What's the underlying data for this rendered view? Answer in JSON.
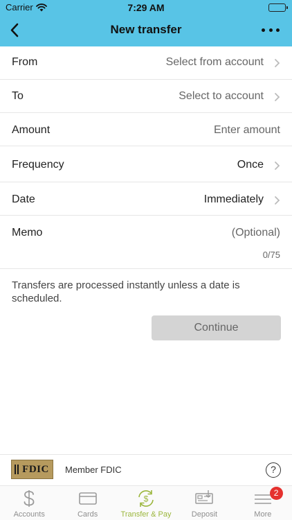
{
  "status_bar": {
    "carrier": "Carrier",
    "time": "7:29 AM"
  },
  "nav": {
    "title": "New transfer"
  },
  "form": {
    "from": {
      "label": "From",
      "value": "Select from account"
    },
    "to": {
      "label": "To",
      "value": "Select to account"
    },
    "amount": {
      "label": "Amount",
      "placeholder": "Enter amount"
    },
    "frequency": {
      "label": "Frequency",
      "value": "Once"
    },
    "date": {
      "label": "Date",
      "value": "Immediately"
    },
    "memo": {
      "label": "Memo",
      "placeholder": "(Optional)",
      "counter": "0/75"
    }
  },
  "info_text": "Transfers are processed instantly unless a date is scheduled.",
  "continue_label": "Continue",
  "footer": {
    "logo_text": "FDIC",
    "member_text": "Member FDIC",
    "help_symbol": "?"
  },
  "tabs": [
    {
      "label": "Accounts",
      "icon": "dollar-icon"
    },
    {
      "label": "Cards",
      "icon": "card-icon"
    },
    {
      "label": "Transfer & Pay",
      "icon": "transfer-icon",
      "active": true
    },
    {
      "label": "Deposit",
      "icon": "check-deposit-icon"
    },
    {
      "label": "More",
      "icon": "menu-icon",
      "badge": "2"
    }
  ],
  "colors": {
    "header": "#58c4e6",
    "active_tab": "#9bb63c",
    "badge": "#e5312e",
    "button_disabled": "#d4d4d4"
  }
}
